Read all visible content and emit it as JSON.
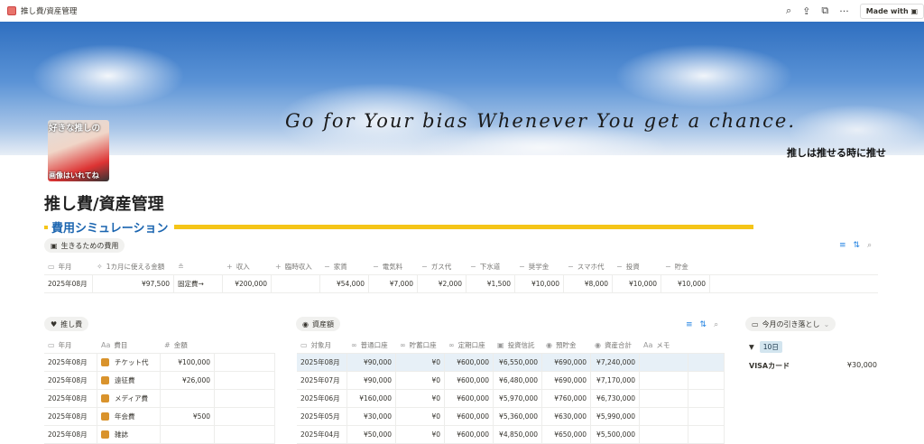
{
  "topbar": {
    "breadcrumb": "推し費/資産管理",
    "made_with": "Made with",
    "icons": [
      "search-icon",
      "share-icon",
      "duplicate-icon",
      "more-icon"
    ]
  },
  "banner": {
    "quote": "Go for Your bias Whenever You get a chance.",
    "subtitle": "推しは推せる時に推せ"
  },
  "page_icon": {
    "top_text": "好きな推しの",
    "bottom_text": "画像はいれてね"
  },
  "page_title": "推し費/資産管理",
  "section_title": "費用シミュレーション",
  "colors": {
    "accent_yellow": "#f5c518",
    "heading_blue": "#1b65b0",
    "selected_row": "#e7f0f7"
  },
  "living": {
    "view_label": "生きるための費用",
    "columns": [
      {
        "icon": "▭",
        "label": "年月"
      },
      {
        "icon": "✧",
        "label": "1カ月に使える金額"
      },
      {
        "icon": "≗",
        "label": ""
      },
      {
        "icon": "+",
        "label": "収入"
      },
      {
        "icon": "+",
        "label": "臨時収入"
      },
      {
        "icon": "−",
        "label": "家賃"
      },
      {
        "icon": "−",
        "label": "電気料"
      },
      {
        "icon": "−",
        "label": "ガス代"
      },
      {
        "icon": "−",
        "label": "下水道"
      },
      {
        "icon": "−",
        "label": "奨学金"
      },
      {
        "icon": "−",
        "label": "スマホ代"
      },
      {
        "icon": "−",
        "label": "投資"
      },
      {
        "icon": "−",
        "label": "貯金"
      }
    ],
    "rows": [
      [
        "2025年08月",
        "¥97,500",
        "固定費→",
        "¥200,000",
        "",
        "¥54,000",
        "¥7,000",
        "¥2,000",
        "¥1,500",
        "¥10,000",
        "¥8,000",
        "¥10,000",
        "¥10,000"
      ]
    ]
  },
  "oshi": {
    "view_label": "推し費",
    "columns": [
      {
        "icon": "▭",
        "label": "年月"
      },
      {
        "icon": "Aa",
        "label": "費目"
      },
      {
        "icon": "#",
        "label": "金額"
      },
      {
        "icon": "",
        "label": ""
      }
    ],
    "rows": [
      [
        "2025年08月",
        "チケット代",
        "¥100,000",
        ""
      ],
      [
        "2025年08月",
        "遠征費",
        "¥26,000",
        ""
      ],
      [
        "2025年08月",
        "メディア費",
        "",
        ""
      ],
      [
        "2025年08月",
        "年会費",
        "¥500",
        ""
      ],
      [
        "2025年08月",
        "雑誌",
        "",
        ""
      ]
    ]
  },
  "assets": {
    "view_label": "資産額",
    "columns": [
      {
        "icon": "▭",
        "label": "対象月"
      },
      {
        "icon": "∞",
        "label": "普通口座"
      },
      {
        "icon": "∞",
        "label": "貯蓄口座"
      },
      {
        "icon": "∞",
        "label": "定期口座"
      },
      {
        "icon": "▣",
        "label": "投資信託"
      },
      {
        "icon": "◉",
        "label": "預貯金"
      },
      {
        "icon": "◉",
        "label": "資産合計"
      },
      {
        "icon": "Aa",
        "label": "メモ"
      },
      {
        "icon": "",
        "label": ""
      }
    ],
    "rows": [
      [
        "2025年08月",
        "¥90,000",
        "¥0",
        "¥600,000",
        "¥6,550,000",
        "¥690,000",
        "¥7,240,000",
        "",
        ""
      ],
      [
        "2025年07月",
        "¥90,000",
        "¥0",
        "¥600,000",
        "¥6,480,000",
        "¥690,000",
        "¥7,170,000",
        "",
        ""
      ],
      [
        "2025年06月",
        "¥160,000",
        "¥0",
        "¥600,000",
        "¥5,970,000",
        "¥760,000",
        "¥6,730,000",
        "",
        ""
      ],
      [
        "2025年05月",
        "¥30,000",
        "¥0",
        "¥600,000",
        "¥5,360,000",
        "¥630,000",
        "¥5,990,000",
        "",
        ""
      ],
      [
        "2025年04月",
        "¥50,000",
        "¥0",
        "¥600,000",
        "¥4,850,000",
        "¥650,000",
        "¥5,500,000",
        "",
        ""
      ]
    ]
  },
  "withdrawal": {
    "view_label": "今月の引き落とし",
    "group": "10日",
    "items": [
      {
        "name": "VISAカード",
        "amount": "¥30,000"
      }
    ]
  }
}
